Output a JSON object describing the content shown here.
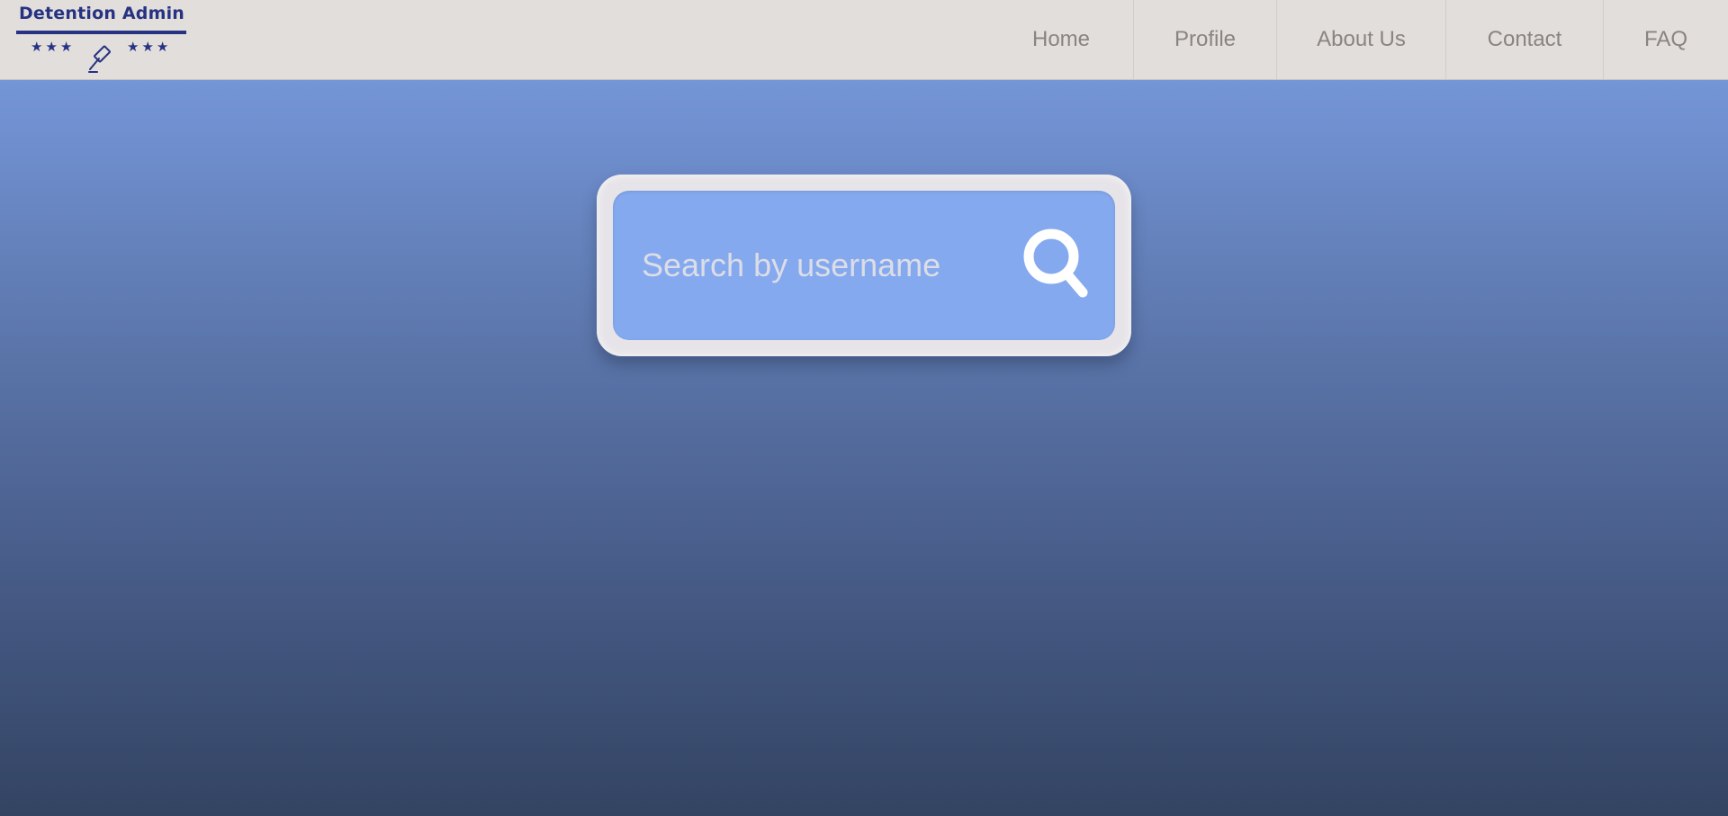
{
  "app": {
    "brand": {
      "title": "Detention Admin",
      "stars_left": "★★★",
      "stars_right": "★★★",
      "emblem_icon": "gavel-icon",
      "color": "#263282"
    }
  },
  "nav": {
    "items": [
      {
        "label": "Home"
      },
      {
        "label": "Profile"
      },
      {
        "label": "About Us"
      },
      {
        "label": "Contact"
      },
      {
        "label": "FAQ"
      }
    ]
  },
  "search": {
    "placeholder": "Search by username",
    "value": "",
    "button_icon": "search-icon"
  },
  "colors": {
    "navbar_bg": "#e2dedb",
    "nav_text": "#8a8480",
    "search_field_bg": "#84a9ee",
    "search_frame_bg": "#e6e4e8",
    "page_gradient_top": "#7a9ee0",
    "page_gradient_bottom": "#334462"
  }
}
